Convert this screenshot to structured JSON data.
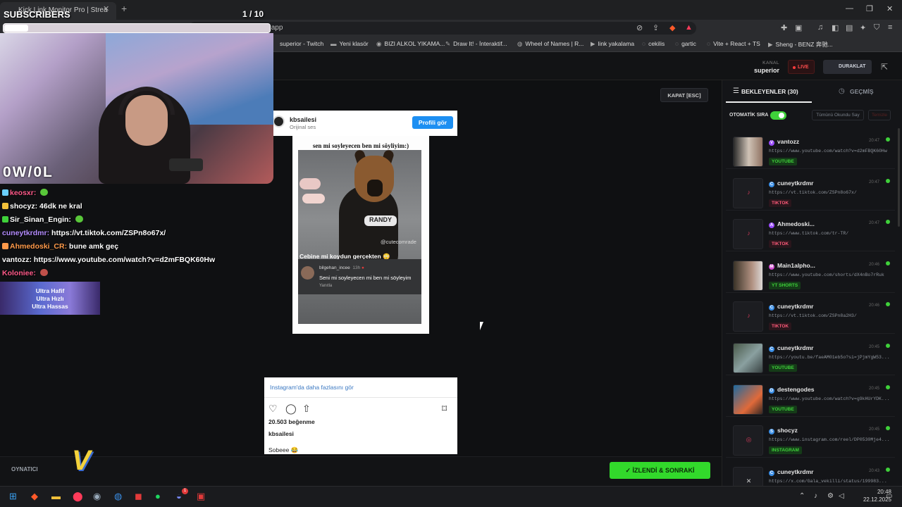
{
  "browser": {
    "tab_title": "Kick Link Monitor Pro | Strea",
    "url": "linkyakalama.netlify.app",
    "bookmarks": [
      {
        "icon": "twitch-icon",
        "label": "superior - Twitch"
      },
      {
        "icon": "folder-icon",
        "label": "Yeni klasör"
      },
      {
        "icon": "burger-icon",
        "label": "BIZI ALKOL YIKAMA..."
      },
      {
        "icon": "draw-icon",
        "label": "Draw It! - İnteraktif..."
      },
      {
        "icon": "wheel-icon",
        "label": "Wheel of Names | R..."
      },
      {
        "icon": "play-icon",
        "label": "link yakalama"
      },
      {
        "icon": "globe-icon",
        "label": "cekilis"
      },
      {
        "icon": "globe-icon",
        "label": "gartic"
      },
      {
        "icon": "globe-icon",
        "label": "Vite + React + TS"
      },
      {
        "icon": "youtube-icon",
        "label": "Sheng - BENZ 奔驰..."
      }
    ]
  },
  "header": {
    "channel_label": "KANAL",
    "channel_value": "superior",
    "live_label": "LIVE",
    "pause_label": "DURAKLAT"
  },
  "main": {
    "close_label": "KAPAT [ESC]",
    "player_label": "OYNATICI",
    "next_label": "İZLENDİ & SONRAKİ"
  },
  "instagram": {
    "username": "kbsailesi",
    "subtitle": "Orijinal ses",
    "profile_button": "Profili gör",
    "video_caption": "sen mi soyleyecen ben mi söyliyim:)",
    "collar_text": "RANDY",
    "watermark": "@cutecomrade",
    "overlay_line": "Cebine mi koydun gerçekten 😳",
    "comment_user": "bilgehan_incee",
    "comment_time": "13h",
    "comment_text": "Seni mi soyleyecen mi ben mi söyleyim",
    "comment_reply": "Yanıtla",
    "more_link": "Instagram'da daha fazlasını gör",
    "likes": "20.503 beğenme",
    "owner": "kbsailesi",
    "caption": "Sobeee 😂"
  },
  "overlay": {
    "subscribers_label": "SUBSCRIBERS",
    "counter": "1  / 10",
    "cam_logo": "0W/0L",
    "ultra_lines": [
      "Ultra Hafif",
      "Ultra Hızlı",
      "Ultra Hassas"
    ],
    "chat": [
      {
        "user": "keosxr:",
        "color": "#ff5a8a",
        "text": ""
      },
      {
        "user": "shocyz:",
        "color": "#ffffff",
        "text": "46dk ne kral"
      },
      {
        "user": "Sir_Sinan_Engin:",
        "color": "#ffffff",
        "text": ""
      },
      {
        "user": "cuneytkrdmr:",
        "color": "#b48cff",
        "text": "https://vt.tiktok.com/ZSPn8o67x/"
      },
      {
        "user": "Ahmedoski_CR:",
        "color": "#ff9a4a",
        "text": "bune amk geç"
      },
      {
        "user": "vantozz:",
        "color": "#ffffff",
        "text": "https://www.youtube.com/watch?v=d2mFBQK60Hw"
      },
      {
        "user": "Koloniee:",
        "color": "#ff5a8a",
        "text": ""
      }
    ]
  },
  "panel": {
    "tab_waiting": "BEKLEYENLER (30)",
    "tab_history": "GEÇMİŞ",
    "auto_queue": "OTOMATİK SIRA",
    "read_all": "Tümünü Okundu Say",
    "clear": "Temizle",
    "items": [
      {
        "user": "vantozz",
        "badge_color": "#9b4dff",
        "badge": "V",
        "time": "20:47",
        "url": "https://www.youtube.com/watch?v=d2mFBQK60Hw",
        "platform": "YOUTUBE",
        "ptype": "yt",
        "thumb": "photo"
      },
      {
        "user": "cuneytkrdmr",
        "badge_color": "#3a8ee6",
        "badge": "C",
        "time": "20:47",
        "url": "https://vt.tiktok.com/ZSPn8o67x/",
        "platform": "TIKTOK",
        "ptype": "tt",
        "thumb": "blank"
      },
      {
        "user": "Ahmedoski...",
        "badge_color": "#9b4dff",
        "badge": "A",
        "time": "20:47",
        "url": "https://www.tiktok.com/tr-TR/",
        "platform": "TIKTOK",
        "ptype": "tt",
        "thumb": "blank"
      },
      {
        "user": "Main1alpho...",
        "badge_color": "#d14dd1",
        "badge": "M",
        "time": "20:46",
        "url": "https://www.youtube.com/shorts/dX4nBo7rRuk",
        "platform": "YT SHORTS",
        "ptype": "yt",
        "thumb": "photo"
      },
      {
        "user": "cuneytkrdmr",
        "badge_color": "#3a8ee6",
        "badge": "C",
        "time": "20:46",
        "url": "https://vt.tiktok.com/ZSPn8a2H3/",
        "platform": "TIKTOK",
        "ptype": "tt",
        "thumb": "blank"
      },
      {
        "user": "cuneytkrdmr",
        "badge_color": "#3a8ee6",
        "badge": "C",
        "time": "20:45",
        "url": "https://youtu.be/faeAM01eb5o?si=jPjmYgW53...",
        "platform": "YOUTUBE",
        "ptype": "yt",
        "thumb": "photo"
      },
      {
        "user": "destengodes",
        "badge_color": "#3a8ee6",
        "badge": "D",
        "time": "20:45",
        "url": "https://www.youtube.com/watch?v=g9kHUrYDK...",
        "platform": "YOUTUBE",
        "ptype": "yt",
        "thumb": "photo"
      },
      {
        "user": "shocyz",
        "badge_color": "#3a8ee6",
        "badge": "S",
        "time": "20:45",
        "url": "https://www.instagram.com/reel/DP0530Mje4...",
        "platform": "INSTAGRAM",
        "ptype": "ig",
        "thumb": "blank"
      },
      {
        "user": "cuneytkrdmr",
        "badge_color": "#3a8ee6",
        "badge": "C",
        "time": "20:43",
        "url": "https://x.com/Gala_vekilli/status/199983...",
        "platform": "",
        "ptype": "x",
        "thumb": "x"
      }
    ]
  },
  "taskbar": {
    "time": "20:48",
    "date": "22.12.2025",
    "notif_count": "1"
  },
  "colors": {
    "accent_green": "#32d92b",
    "live_red": "#ff3b3b",
    "panel_bg": "#141518"
  }
}
